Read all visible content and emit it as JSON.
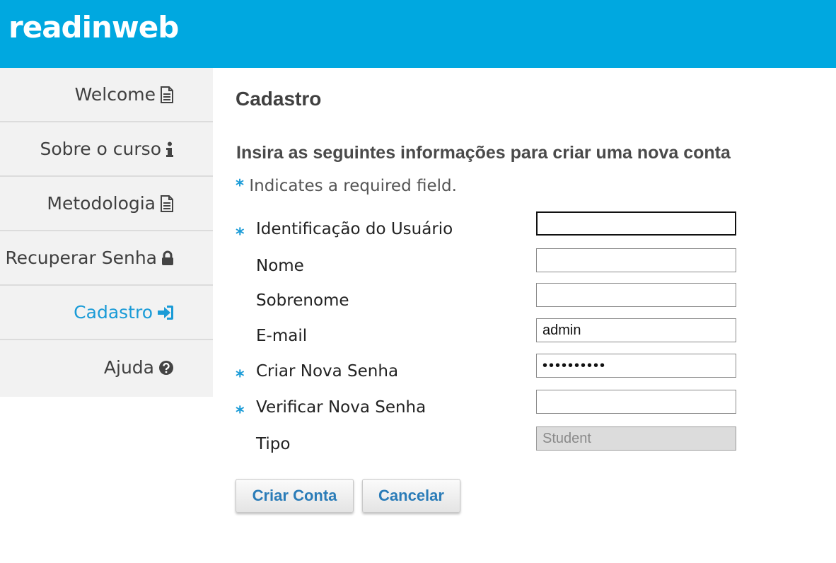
{
  "app": {
    "logo": "readinweb"
  },
  "sidebar": {
    "items": [
      {
        "label": "Welcome",
        "icon": "document-icon"
      },
      {
        "label": "Sobre o curso",
        "icon": "info-icon"
      },
      {
        "label": "Metodologia",
        "icon": "document-icon"
      },
      {
        "label": "Recuperar Senha",
        "icon": "lock-icon"
      },
      {
        "label": "Cadastro",
        "icon": "sign-in-icon",
        "active": true
      },
      {
        "label": "Ajuda",
        "icon": "question-circle-icon"
      }
    ]
  },
  "main": {
    "title": "Cadastro",
    "subtitle": "Insira as seguintes informações para criar uma nova conta",
    "required_star": "*",
    "required_note": "Indicates a required field.",
    "fields": [
      {
        "label": "Identificação do Usuário",
        "required": true,
        "value": ""
      },
      {
        "label": "Nome",
        "required": false,
        "value": ""
      },
      {
        "label": "Sobrenome",
        "required": false,
        "value": ""
      },
      {
        "label": "E-mail",
        "required": false,
        "value": "admin"
      },
      {
        "label": "Criar Nova Senha",
        "required": true,
        "value": "••••••••••"
      },
      {
        "label": "Verificar Nova Senha",
        "required": true,
        "value": ""
      },
      {
        "label": "Tipo",
        "required": false,
        "value": "Student"
      }
    ],
    "buttons": {
      "create": "Criar Conta",
      "cancel": "Cancelar"
    }
  },
  "colors": {
    "accent": "#00a8e0",
    "link": "#1a9bd7"
  }
}
